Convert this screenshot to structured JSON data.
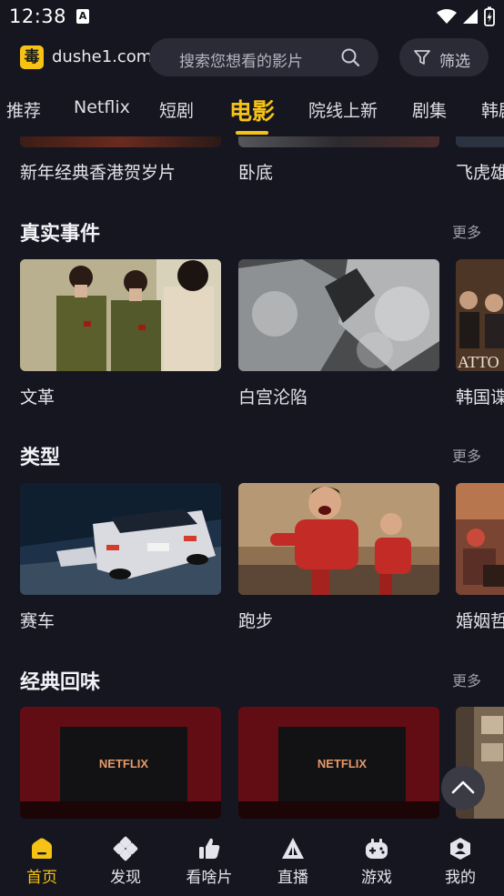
{
  "status_bar": {
    "time": "12:38",
    "notification_icon": "a-icon"
  },
  "header": {
    "logo_char": "毒",
    "site_name": "dushe1.com",
    "search_placeholder": "搜索您想看的影片",
    "filter_label": "筛选"
  },
  "tabs": [
    {
      "label": "推荐"
    },
    {
      "label": "Netflix"
    },
    {
      "label": "短剧"
    },
    {
      "label": "电影",
      "active": true
    },
    {
      "label": "院线上新"
    },
    {
      "label": "剧集"
    },
    {
      "label": "韩剧"
    }
  ],
  "top_row": {
    "items": [
      "新年经典香港贺岁片",
      "卧底",
      "飞虎雄心"
    ]
  },
  "sections": [
    {
      "title": "真实事件",
      "more": "更多",
      "items": [
        "文革",
        "白宫沦陷",
        "韩国谍战"
      ]
    },
    {
      "title": "类型",
      "more": "更多",
      "items": [
        "赛车",
        "跑步",
        "婚姻哲学"
      ]
    },
    {
      "title": "经典回味",
      "more": "更多",
      "thumb_text": "NETFLIX"
    }
  ],
  "poster_text": "ATTO",
  "bottom_nav": [
    {
      "label": "首页",
      "icon": "home-icon",
      "active": true
    },
    {
      "label": "发现",
      "icon": "discover-icon"
    },
    {
      "label": "看啥片",
      "icon": "thumbs-up-icon"
    },
    {
      "label": "直播",
      "icon": "live-icon"
    },
    {
      "label": "游戏",
      "icon": "gamepad-icon"
    },
    {
      "label": "我的",
      "icon": "profile-icon"
    }
  ],
  "colors": {
    "accent": "#f6c315",
    "background": "#15161f",
    "surface": "#2a2b36"
  }
}
